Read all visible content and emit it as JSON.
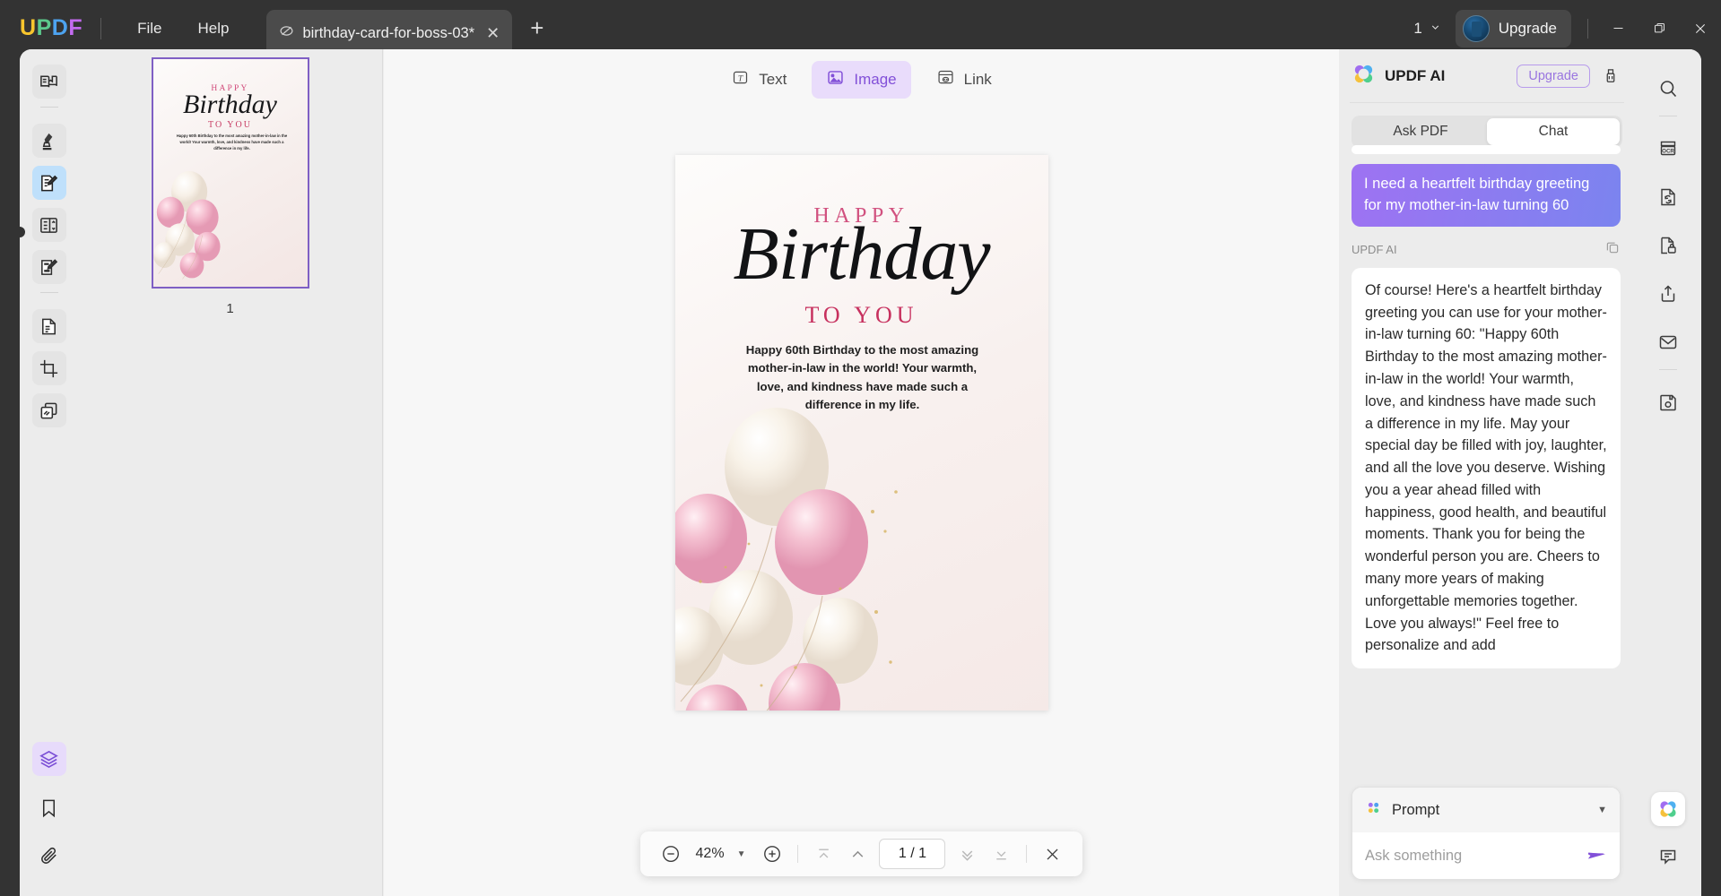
{
  "titlebar": {
    "logo": {
      "letters": [
        "U",
        "P",
        "D",
        "F"
      ],
      "colors": [
        "#F7C52D",
        "#5CC98C",
        "#4DA3F0",
        "#C36BF0"
      ]
    },
    "menus": [
      {
        "label": "File",
        "name": "menu-file"
      },
      {
        "label": "Help",
        "name": "menu-help"
      }
    ],
    "tab": {
      "title": "birthday-card-for-boss-03*",
      "close": "✕",
      "icon": "pdf-slash-icon"
    },
    "new_tab": "+",
    "window_count": "1",
    "window_count_caret": "∨",
    "upgrade_label": "Upgrade",
    "window_controls": {
      "minimize": "—",
      "maximize": "❐",
      "close": "✕"
    }
  },
  "left_rail": {
    "items": [
      {
        "name": "sidebar-item-reader",
        "icon": "book-reader-icon",
        "state": "normal"
      },
      {
        "name": "sidebar-item-annotate",
        "icon": "highlighter-marker-icon",
        "state": "normal"
      },
      {
        "name": "sidebar-item-edit-pdf",
        "icon": "edit-document-pencil-icon",
        "state": "selected"
      },
      {
        "name": "sidebar-item-organize-pages",
        "icon": "page-organizer-icon",
        "state": "normal"
      },
      {
        "name": "sidebar-item-fill-sign",
        "icon": "sign-document-icon",
        "state": "normal"
      },
      {
        "name": "sidebar-item-forms",
        "icon": "form-document-icon",
        "state": "normal"
      },
      {
        "name": "sidebar-item-crop",
        "icon": "crop-icon",
        "state": "normal"
      },
      {
        "name": "sidebar-item-batch",
        "icon": "stacked-pages-icon",
        "state": "normal"
      },
      {
        "name": "sidebar-item-layers",
        "icon": "layers-icon",
        "state": "purple"
      },
      {
        "name": "sidebar-item-bookmarks",
        "icon": "bookmark-icon",
        "state": "plain"
      },
      {
        "name": "sidebar-item-attachments",
        "icon": "paperclip-icon",
        "state": "plain"
      }
    ]
  },
  "thumbnails": {
    "page_label": "1"
  },
  "card": {
    "happy": "HAPPY",
    "birthday": "Birthday",
    "to_you": "TO YOU",
    "body": "Happy 60th Birthday to the most amazing mother-in-law in the world! Your warmth, love, and kindness have made such a difference in my life."
  },
  "edit_tabs": [
    {
      "label": "Text",
      "name": "tab-text",
      "icon": "text-box-icon",
      "active": false
    },
    {
      "label": "Image",
      "name": "tab-image",
      "icon": "image-icon",
      "active": true
    },
    {
      "label": "Link",
      "name": "tab-link",
      "icon": "link-icon",
      "active": false
    }
  ],
  "zoombar": {
    "zoom_out": "−",
    "zoom_level": "42%",
    "zoom_caret": "▼",
    "zoom_in": "+",
    "first_page": "first-page-icon",
    "prev_page": "prev-page-icon",
    "page_indicator": "1 / 1",
    "next_page": "next-page-icon",
    "last_page": "last-page-icon",
    "close": "✕"
  },
  "ai_panel": {
    "title": "UPDF AI",
    "logo_icon": "updf-ai-clover-icon",
    "upgrade_label": "Upgrade",
    "clear_icon": "brush-clean-icon",
    "tabs": [
      {
        "label": "Ask PDF",
        "name": "ai-tab-ask-pdf",
        "active": false
      },
      {
        "label": "Chat",
        "name": "ai-tab-chat",
        "active": true
      }
    ],
    "user_message": "I need a heartfelt birthday greeting for my mother-in-law turning 60",
    "assistant_label": "UPDF AI",
    "copy_icon": "copy-icon",
    "assistant_message": "Of course! Here's a heartfelt birthday greeting you can use for your mother-in-law turning 60:\n\"Happy 60th Birthday to the most amazing mother-in-law in the world! Your warmth, love, and kindness have made such a difference in my life. May your special day be filled with joy, laughter, and all the love you deserve. Wishing you a year ahead filled with happiness, good health, and beautiful moments. Thank you for being the wonderful person you are. Cheers to many more years of making unforgettable memories together. Love you always!\"\nFeel free to personalize and add",
    "prompt_label": "Prompt",
    "prompt_caret": "▼",
    "input_placeholder": "Ask something",
    "send_icon": "send-arrow-icon"
  },
  "right_rail": {
    "items": [
      {
        "name": "search-icon",
        "label": "Search"
      },
      {
        "name": "ocr-icon",
        "label": "OCR"
      },
      {
        "name": "convert-icon",
        "label": "Convert"
      },
      {
        "name": "protect-lock-icon",
        "label": "Protect"
      },
      {
        "name": "share-export-icon",
        "label": "Share"
      },
      {
        "name": "email-envelope-icon",
        "label": "Email"
      },
      {
        "name": "save-floppy-icon",
        "label": "Save"
      }
    ],
    "bottom_items": [
      {
        "name": "updf-ai-launcher-icon",
        "label": "UPDF AI"
      },
      {
        "name": "comment-bubble-icon",
        "label": "Comments"
      }
    ]
  },
  "colors": {
    "accent_purple": "#8250d8",
    "titlebar": "#333333",
    "panel_bg": "#ececec",
    "card_pink": "#d1517f"
  }
}
